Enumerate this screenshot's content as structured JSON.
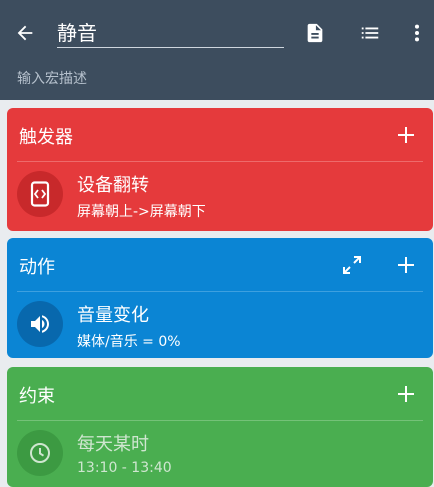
{
  "appbar": {
    "title_value": "静音",
    "description_placeholder": "输入宏描述",
    "icons": {
      "back": "arrow-left-icon",
      "document": "document-icon",
      "list": "list-icon",
      "more": "more-vert-icon"
    }
  },
  "trigger": {
    "header": "触发器",
    "color": "#e53a3c",
    "item": {
      "title": "设备翻转",
      "subtitle": "屏幕朝上->屏幕朝下",
      "icon": "device-flip-icon"
    }
  },
  "action": {
    "header": "动作",
    "color": "#0b85d4",
    "item": {
      "title": "音量变化",
      "subtitle": "媒体/音乐 = 0%",
      "icon": "volume-icon"
    }
  },
  "constraint": {
    "header": "约束",
    "color": "#4aae50",
    "item": {
      "title": "每天某时",
      "subtitle": "13:10 - 13:40",
      "icon": "clock-icon"
    }
  }
}
